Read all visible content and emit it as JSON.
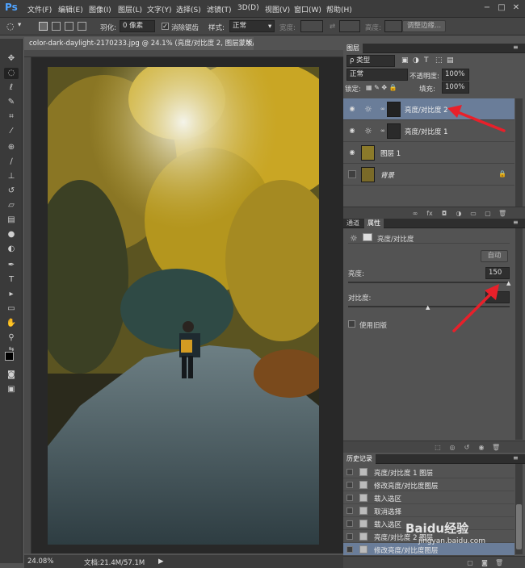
{
  "app": {
    "logo": "Ps"
  },
  "menu": [
    "文件(F)",
    "编辑(E)",
    "图像(I)",
    "图层(L)",
    "文字(Y)",
    "选择(S)",
    "滤镜(T)",
    "3D(D)",
    "视图(V)",
    "窗口(W)",
    "帮助(H)"
  ],
  "window_controls": [
    "−",
    "□",
    "✕"
  ],
  "options": {
    "feather_label": "羽化:",
    "feather_value": "0 像素",
    "antialias_label": "消除锯齿",
    "style_label": "样式:",
    "style_value": "正常",
    "width_label": "宽度:",
    "height_label": "高度:",
    "refine_button": "调整边缘..."
  },
  "document": {
    "tab_title": "color-dark-daylight-2170233.jpg @ 24.1% (亮度/对比度 2, 图层蒙版/8) *",
    "tab_close": "×",
    "zoom": "24.08%",
    "doc_size": "文档:21.4M/57.1M"
  },
  "layers_panel": {
    "tab": "图层",
    "filter_kind": "类型",
    "blend_mode": "正常",
    "opacity_label": "不透明度:",
    "opacity_value": "100%",
    "lock_label": "锁定:",
    "fill_label": "填充:",
    "fill_value": "100%",
    "layers": [
      {
        "name": "亮度/对比度 2",
        "selected": true,
        "visible": true,
        "type": "adjustment"
      },
      {
        "name": "亮度/对比度 1",
        "selected": false,
        "visible": true,
        "type": "adjustment"
      },
      {
        "name": "图层 1",
        "selected": false,
        "visible": true,
        "type": "pixel"
      },
      {
        "name": "背景",
        "selected": false,
        "visible": false,
        "type": "background",
        "locked": true
      }
    ]
  },
  "properties_panel": {
    "tabs": [
      "通道",
      "属性"
    ],
    "active_tab": "属性",
    "title": "亮度/对比度",
    "auto_button": "自动",
    "brightness_label": "亮度:",
    "brightness_value": "150",
    "contrast_label": "对比度:",
    "contrast_value": "",
    "legacy_label": "使用旧版",
    "brightness_fraction": 1.0,
    "contrast_fraction": 0.5
  },
  "history_panel": {
    "tab": "历史记录",
    "items": [
      {
        "label": "亮度/对比度 1 图层",
        "selected": false
      },
      {
        "label": "修改亮度/对比度图层",
        "selected": false
      },
      {
        "label": "载入选区",
        "selected": false
      },
      {
        "label": "取消选择",
        "selected": false
      },
      {
        "label": "载入选区",
        "selected": false
      },
      {
        "label": "亮度/对比度 2 图层",
        "selected": false
      },
      {
        "label": "修改亮度/对比度图层",
        "selected": true
      }
    ]
  },
  "watermark": {
    "text": "Baidu经验",
    "sub": "jingyan.baidu.com"
  },
  "colors": {
    "accent_arrow": "#e8202a",
    "selection": "#6a7d99",
    "panel_bg": "#535353"
  }
}
